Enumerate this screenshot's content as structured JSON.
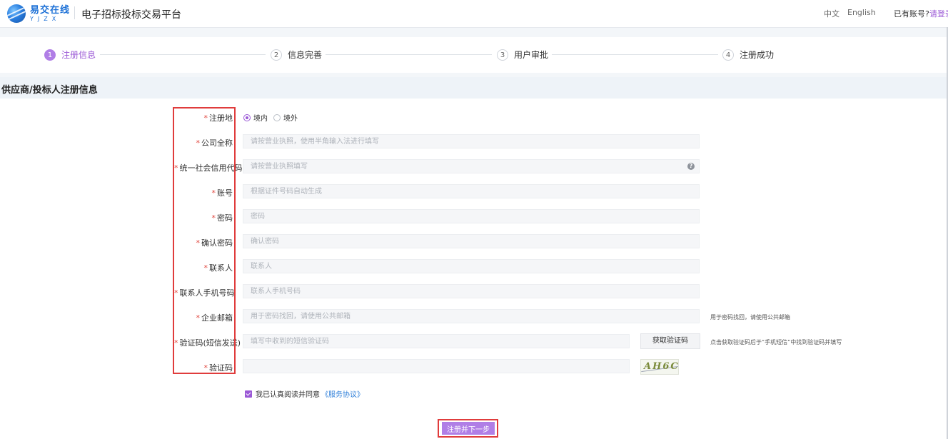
{
  "header": {
    "logo_cn": "易交在线",
    "logo_en": "YJZX",
    "title": "电子招标投标交易平台",
    "lang_zh": "中文",
    "lang_en": "English",
    "has_account": "已有账号?",
    "login_link": "请登录"
  },
  "steps": [
    {
      "num": "1",
      "label": "注册信息",
      "active": true
    },
    {
      "num": "2",
      "label": "信息完善",
      "active": false
    },
    {
      "num": "3",
      "label": "用户审批",
      "active": false
    },
    {
      "num": "4",
      "label": "注册成功",
      "active": false
    }
  ],
  "section_title": "供应商/投标人注册信息",
  "form": {
    "region": {
      "label": "注册地",
      "options": [
        "境内",
        "境外"
      ],
      "selected": "境内"
    },
    "company_name": {
      "label": "公司全称",
      "placeholder": "请按营业执照，使用半角输入法进行填写",
      "value": ""
    },
    "credit_code": {
      "label": "统一社会信用代码",
      "placeholder": "请按营业执照填写",
      "value": "",
      "help": "?"
    },
    "account": {
      "label": "账号",
      "placeholder": "根据证件号码自动生成",
      "value": ""
    },
    "password": {
      "label": "密码",
      "placeholder": "密码",
      "value": ""
    },
    "confirm_password": {
      "label": "确认密码",
      "placeholder": "确认密码",
      "value": ""
    },
    "contact": {
      "label": "联系人",
      "placeholder": "联系人",
      "value": ""
    },
    "contact_phone": {
      "label": "联系人手机号码",
      "placeholder": "联系人手机号码",
      "value": ""
    },
    "email": {
      "label": "企业邮箱",
      "placeholder": "用于密码找回，请使用公共邮箱",
      "value": "",
      "hint": "用于密码找回，请使用公共邮箱"
    },
    "sms_code": {
      "label": "验证码(短信发送)",
      "placeholder": "填写中收到的短信验证码",
      "value": "",
      "button": "获取验证码",
      "hint": "点击获取验证码后于“手机短信”中找到验证码并填写"
    },
    "captcha": {
      "label": "验证码",
      "placeholder": "",
      "value": "",
      "image_text": "AH6C"
    },
    "agreement": {
      "text": "我已认真阅读并同意",
      "link": "《服务协议》",
      "checked": true
    },
    "submit": "注册并下一步"
  },
  "colors": {
    "accent": "#b07ee6",
    "accent_text": "#9b59d6",
    "required_star": "#e0443c",
    "highlight": "#e03c3c",
    "link": "#2f7fd9"
  }
}
